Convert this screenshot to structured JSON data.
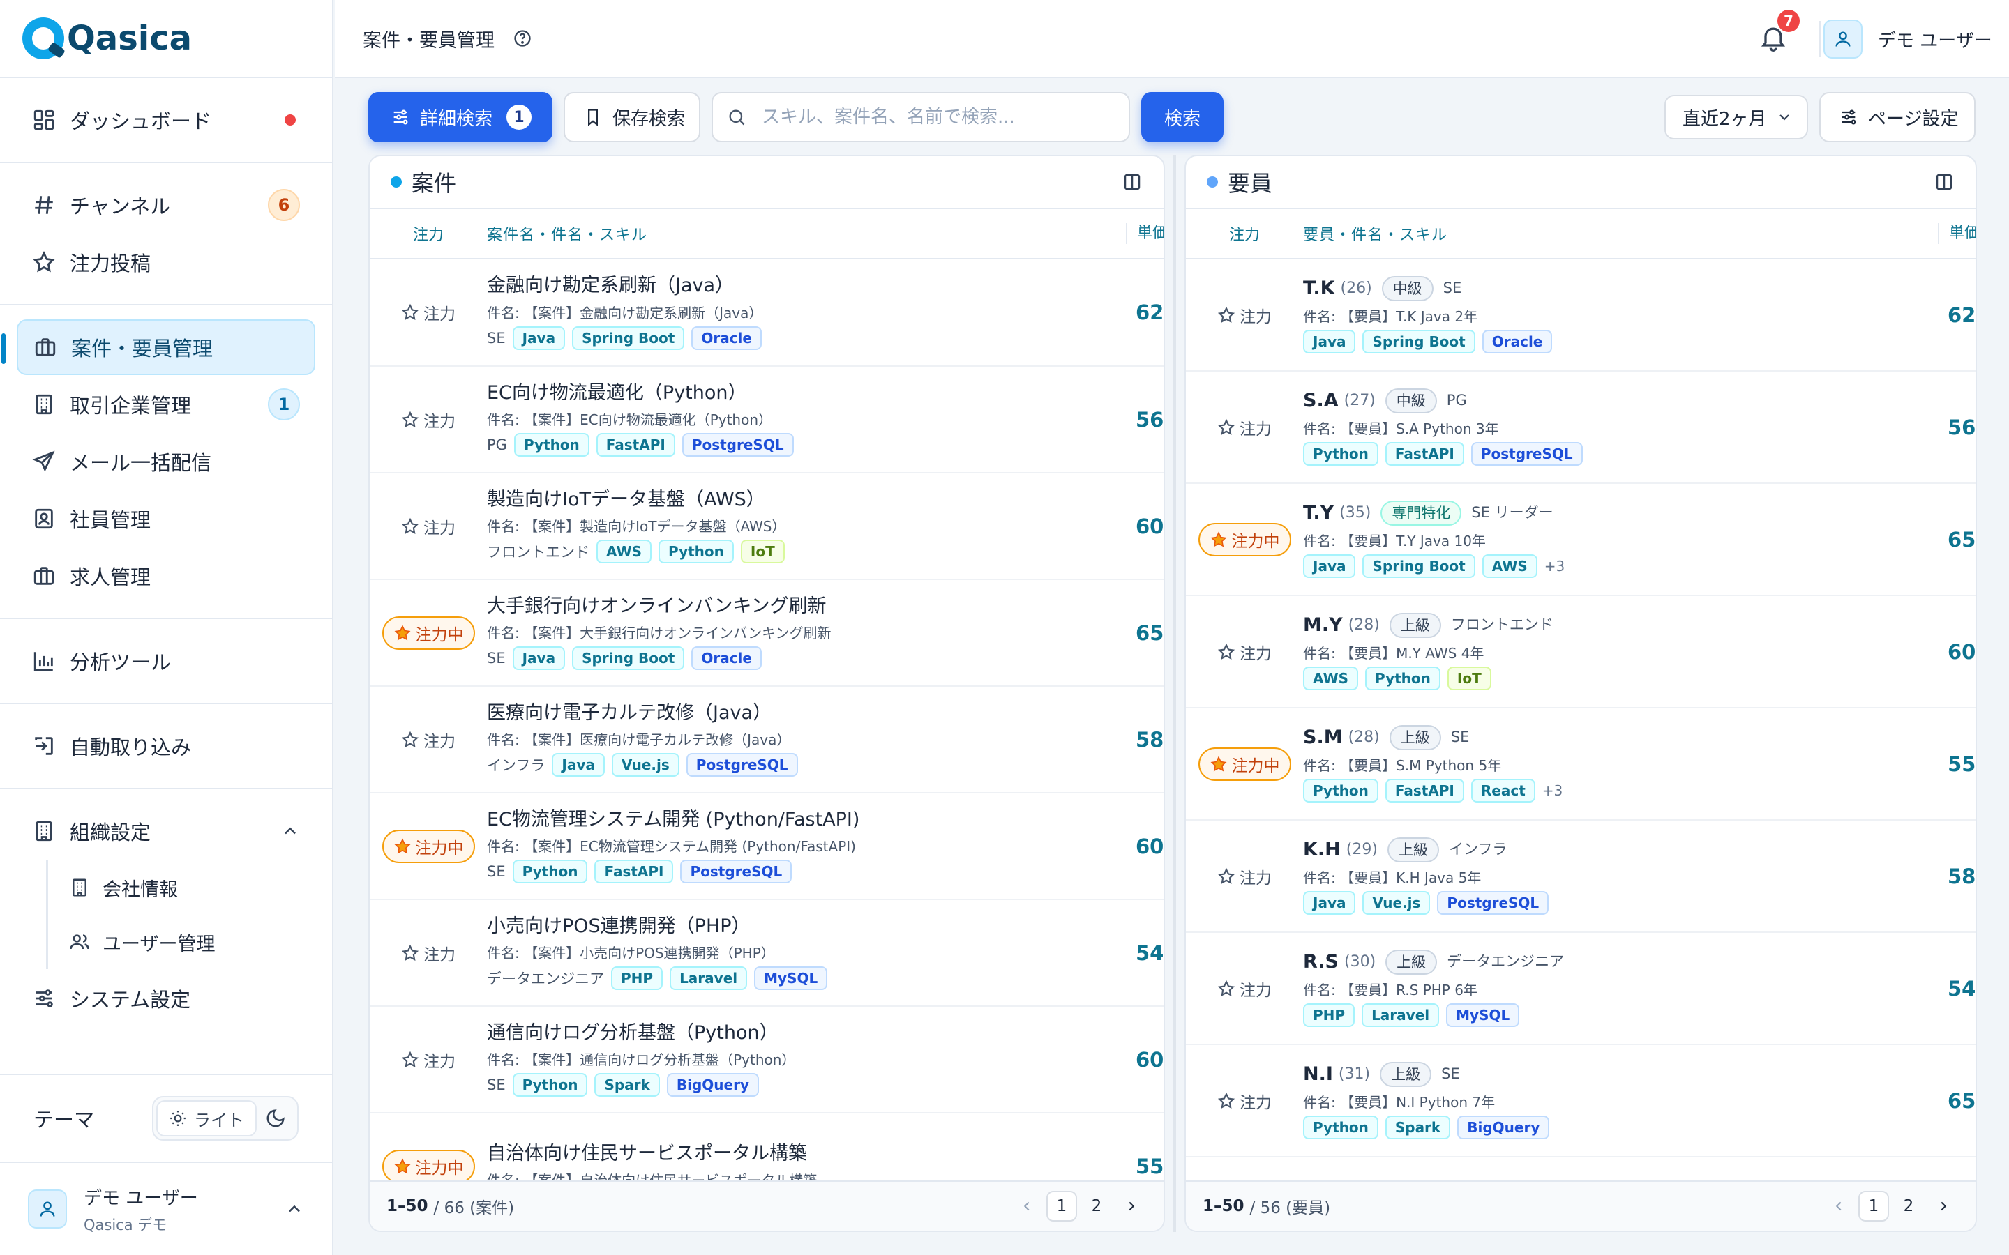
{
  "app": {
    "name": "Qasica",
    "page_title": "案件・要員管理"
  },
  "sidebar": {
    "groups": [
      [
        {
          "id": "dashboard",
          "label": "ダッシュボード",
          "icon": "dashboard-icon",
          "dot": true
        }
      ],
      [
        {
          "id": "channel",
          "label": "チャンネル",
          "icon": "hash-icon",
          "badge": "6",
          "badge_color": "orange"
        },
        {
          "id": "focus-post",
          "label": "注力投稿",
          "icon": "star-icon"
        }
      ],
      [
        {
          "id": "project-staff",
          "label": "案件・要員管理",
          "icon": "briefcase-icon",
          "active": true
        },
        {
          "id": "partners",
          "label": "取引企業管理",
          "icon": "building-icon",
          "badge": "1",
          "badge_color": "blue"
        },
        {
          "id": "mail",
          "label": "メール一括配信",
          "icon": "send-icon"
        },
        {
          "id": "employees",
          "label": "社員管理",
          "icon": "id-card-icon"
        },
        {
          "id": "jobs",
          "label": "求人管理",
          "icon": "briefcase-icon"
        }
      ],
      [
        {
          "id": "analytics",
          "label": "分析ツール",
          "icon": "bar-chart-icon"
        }
      ],
      [
        {
          "id": "import",
          "label": "自動取り込み",
          "icon": "import-icon"
        }
      ]
    ],
    "org": {
      "label": "組織設定",
      "icon": "building-icon",
      "children": [
        {
          "id": "company",
          "label": "会社情報",
          "icon": "building-icon"
        },
        {
          "id": "users",
          "label": "ユーザー管理",
          "icon": "users-icon"
        }
      ]
    },
    "system": {
      "label": "システム設定",
      "icon": "sliders-icon"
    },
    "theme": {
      "label": "テーマ",
      "light": "ライト"
    },
    "user": {
      "name": "デモ ユーザー",
      "org": "Qasica デモ"
    }
  },
  "header": {
    "notifications": "7",
    "user_name": "デモ ユーザー"
  },
  "toolbar": {
    "advanced_search": "詳細検索",
    "advanced_count": "1",
    "saved_search": "保存検索",
    "search_placeholder": "スキル、案件名、名前で検索...",
    "search_button": "検索",
    "period": "直近2ヶ月",
    "page_settings": "ページ設定"
  },
  "colors": {
    "primary": "#2563eb",
    "accent": "#0e7490",
    "focus": "#f59e0b"
  },
  "projects": {
    "title": "案件",
    "columns": {
      "focus": "注力",
      "main": "案件名・件名・スキル",
      "price": "単価"
    },
    "focus_label": "注力",
    "focus_on_label": "注力中",
    "rows": [
      {
        "title": "金融向け勘定系刷新（Java）",
        "subject": "件名: 【案件】金融向け勘定系刷新（Java）",
        "role": "SE",
        "skills": [
          "Java",
          "Spring Boot",
          "Oracle"
        ],
        "price": "62",
        "focus": false
      },
      {
        "title": "EC向け物流最適化（Python）",
        "subject": "件名: 【案件】EC向け物流最適化（Python）",
        "role": "PG",
        "skills": [
          "Python",
          "FastAPI",
          "PostgreSQL"
        ],
        "price": "56",
        "focus": false
      },
      {
        "title": "製造向けIoTデータ基盤（AWS）",
        "subject": "件名: 【案件】製造向けIoTデータ基盤（AWS）",
        "role": "フロントエンド",
        "skills": [
          "AWS",
          "Python",
          "IoT"
        ],
        "price": "60",
        "focus": false
      },
      {
        "title": "大手銀行向けオンラインバンキング刷新",
        "subject": "件名: 【案件】大手銀行向けオンラインバンキング刷新",
        "role": "SE",
        "skills": [
          "Java",
          "Spring Boot",
          "Oracle"
        ],
        "price": "65",
        "focus": true
      },
      {
        "title": "医療向け電子カルテ改修（Java）",
        "subject": "件名: 【案件】医療向け電子カルテ改修（Java）",
        "role": "インフラ",
        "skills": [
          "Java",
          "Vue.js",
          "PostgreSQL"
        ],
        "price": "58",
        "focus": false
      },
      {
        "title": "EC物流管理システム開発 (Python/FastAPI)",
        "subject": "件名: 【案件】EC物流管理システム開発 (Python/FastAPI)",
        "role": "SE",
        "skills": [
          "Python",
          "FastAPI",
          "PostgreSQL"
        ],
        "price": "60",
        "focus": true
      },
      {
        "title": "小売向けPOS連携開発（PHP）",
        "subject": "件名: 【案件】小売向けPOS連携開発（PHP）",
        "role": "データエンジニア",
        "skills": [
          "PHP",
          "Laravel",
          "MySQL"
        ],
        "price": "54",
        "focus": false
      },
      {
        "title": "通信向けログ分析基盤（Python）",
        "subject": "件名: 【案件】通信向けログ分析基盤（Python）",
        "role": "SE",
        "skills": [
          "Python",
          "Spark",
          "BigQuery"
        ],
        "price": "60",
        "focus": false
      },
      {
        "title": "自治体向け住民サービスポータル構築",
        "subject": "件名: 【案件】自治体向け住民サービスポータル構築",
        "role": "",
        "skills": [],
        "price": "55",
        "focus": true
      }
    ],
    "footer": {
      "range": "1–50",
      "total": "/ 66 (案件)",
      "pages": [
        "1",
        "2"
      ]
    }
  },
  "staff": {
    "title": "要員",
    "columns": {
      "focus": "注力",
      "main": "要員・件名・スキル",
      "price": "単価"
    },
    "focus_label": "注力",
    "focus_on_label": "注力中",
    "rows": [
      {
        "name": "T.K",
        "age": "(26)",
        "level": "中級",
        "level_style": "g",
        "role": "SE",
        "subject": "件名: 【要員】T.K Java 2年",
        "skills": [
          "Java",
          "Spring Boot",
          "Oracle"
        ],
        "more": "",
        "price": "62",
        "focus": false
      },
      {
        "name": "S.A",
        "age": "(27)",
        "level": "中級",
        "level_style": "g",
        "role": "PG",
        "subject": "件名: 【要員】S.A Python 3年",
        "skills": [
          "Python",
          "FastAPI",
          "PostgreSQL"
        ],
        "more": "",
        "price": "56",
        "focus": false
      },
      {
        "name": "T.Y",
        "age": "(35)",
        "level": "専門特化",
        "level_style": "t",
        "role": "SE リーダー",
        "subject": "件名: 【要員】T.Y Java 10年",
        "skills": [
          "Java",
          "Spring Boot",
          "AWS"
        ],
        "more": "+3",
        "price": "65",
        "focus": true
      },
      {
        "name": "M.Y",
        "age": "(28)",
        "level": "上級",
        "level_style": "g",
        "role": "フロントエンド",
        "subject": "件名: 【要員】M.Y AWS 4年",
        "skills": [
          "AWS",
          "Python",
          "IoT"
        ],
        "more": "",
        "price": "60",
        "focus": false
      },
      {
        "name": "S.M",
        "age": "(28)",
        "level": "上級",
        "level_style": "g",
        "role": "SE",
        "subject": "件名: 【要員】S.M Python 5年",
        "skills": [
          "Python",
          "FastAPI",
          "React"
        ],
        "more": "+3",
        "price": "55",
        "focus": true
      },
      {
        "name": "K.H",
        "age": "(29)",
        "level": "上級",
        "level_style": "g",
        "role": "インフラ",
        "subject": "件名: 【要員】K.H Java 5年",
        "skills": [
          "Java",
          "Vue.js",
          "PostgreSQL"
        ],
        "more": "",
        "price": "58",
        "focus": false
      },
      {
        "name": "R.S",
        "age": "(30)",
        "level": "上級",
        "level_style": "g",
        "role": "データエンジニア",
        "subject": "件名: 【要員】R.S PHP 6年",
        "skills": [
          "PHP",
          "Laravel",
          "MySQL"
        ],
        "more": "",
        "price": "54",
        "focus": false
      },
      {
        "name": "N.I",
        "age": "(31)",
        "level": "上級",
        "level_style": "g",
        "role": "SE",
        "subject": "件名: 【要員】N.I Python 7年",
        "skills": [
          "Python",
          "Spark",
          "BigQuery"
        ],
        "more": "",
        "price": "65",
        "focus": false
      }
    ],
    "footer": {
      "range": "1–50",
      "total": "/ 56 (要員)",
      "pages": [
        "1",
        "2"
      ]
    }
  }
}
